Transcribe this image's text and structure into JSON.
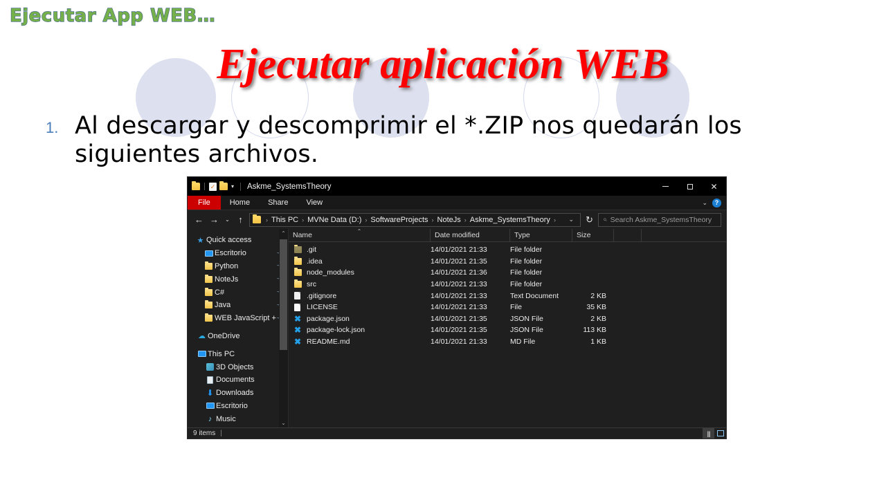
{
  "slide": {
    "kicker": "Ejecutar App WEB…",
    "title": "Ejecutar aplicación WEB",
    "bullet_number": "1.",
    "bullet_text": "Al descargar y descomprimir  el *.ZIP nos quedarán los siguientes archivos.",
    "colors": {
      "kicker_fill": "#76b04a",
      "kicker_stroke": "#3a5f8a",
      "title": "#ff0000",
      "bullet_number": "#4a7ebb",
      "deco_fill": "#dde0ef",
      "deco_outline": "#d3d8ee",
      "background": "#ffffff"
    }
  },
  "explorer": {
    "titlebar": {
      "title": "Askme_SystemsTheory",
      "quick_access": [
        "folder-icon",
        "properties-icon",
        "new-folder-icon",
        "customize-caret-icon"
      ],
      "minimize": "—",
      "maximize": "▢",
      "close": "✕"
    },
    "ribbon": {
      "tabs": [
        "File",
        "Home",
        "Share",
        "View"
      ],
      "collapse": "⌄",
      "help": "?",
      "file_tab_color": "#cc0000"
    },
    "address": {
      "back": "←",
      "forward": "→",
      "recent": "⌄",
      "up": "↑",
      "crumbs": [
        "This PC",
        "MVNe Data (D:)",
        "SoftwareProjects",
        "NoteJs",
        "Askme_SystemsTheory"
      ],
      "dropdown": "⌄",
      "refresh": "↻",
      "search_placeholder": "Search Askme_SystemsTheory"
    },
    "sidebar": {
      "groups": [
        {
          "header": {
            "label": "Quick access",
            "icon": "star-icon"
          },
          "items": [
            {
              "label": "Escritorio",
              "icon": "monitor-icon",
              "pinned": true
            },
            {
              "label": "Python",
              "icon": "folder-icon",
              "pinned": true
            },
            {
              "label": "NoteJs",
              "icon": "folder-icon",
              "pinned": true
            },
            {
              "label": "C#",
              "icon": "folder-icon",
              "pinned": true
            },
            {
              "label": "Java",
              "icon": "folder-icon",
              "pinned": true
            },
            {
              "label": "WEB JavaScript + HTM",
              "icon": "folder-icon",
              "pinned": true
            }
          ]
        },
        {
          "header": {
            "label": "OneDrive",
            "icon": "cloud-icon"
          },
          "items": []
        },
        {
          "header": {
            "label": "This PC",
            "icon": "pc-icon"
          },
          "items": [
            {
              "label": "3D Objects",
              "icon": "cube-icon",
              "pinned": false
            },
            {
              "label": "Documents",
              "icon": "document-icon",
              "pinned": false
            },
            {
              "label": "Downloads",
              "icon": "download-icon",
              "pinned": false
            },
            {
              "label": "Escritorio",
              "icon": "monitor-icon",
              "pinned": false
            },
            {
              "label": "Music",
              "icon": "music-icon",
              "pinned": false
            }
          ]
        }
      ],
      "scroll_up": "⌃",
      "scroll_down": "⌄"
    },
    "columns": [
      "Name",
      "Date modified",
      "Type",
      "Size"
    ],
    "files": [
      {
        "name": ".git",
        "date": "14/01/2021 21:33",
        "type": "File folder",
        "size": "",
        "icon": "folder-dark-icon"
      },
      {
        "name": ".idea",
        "date": "14/01/2021 21:35",
        "type": "File folder",
        "size": "",
        "icon": "folder-icon"
      },
      {
        "name": "node_modules",
        "date": "14/01/2021 21:36",
        "type": "File folder",
        "size": "",
        "icon": "folder-icon"
      },
      {
        "name": "src",
        "date": "14/01/2021 21:33",
        "type": "File folder",
        "size": "",
        "icon": "folder-icon"
      },
      {
        "name": ".gitignore",
        "date": "14/01/2021 21:33",
        "type": "Text Document",
        "size": "2 KB",
        "icon": "text-file-icon"
      },
      {
        "name": "LICENSE",
        "date": "14/01/2021 21:33",
        "type": "File",
        "size": "35 KB",
        "icon": "blank-file-icon"
      },
      {
        "name": "package.json",
        "date": "14/01/2021 21:35",
        "type": "JSON File",
        "size": "2 KB",
        "icon": "vscode-icon"
      },
      {
        "name": "package-lock.json",
        "date": "14/01/2021 21:35",
        "type": "JSON File",
        "size": "113 KB",
        "icon": "vscode-icon"
      },
      {
        "name": "README.md",
        "date": "14/01/2021 21:33",
        "type": "MD File",
        "size": "1 KB",
        "icon": "vscode-icon"
      }
    ],
    "status": {
      "items_count": "9 items",
      "separator": "|",
      "view_details": "details-view-icon",
      "view_tiles": "tiles-view-icon"
    }
  }
}
